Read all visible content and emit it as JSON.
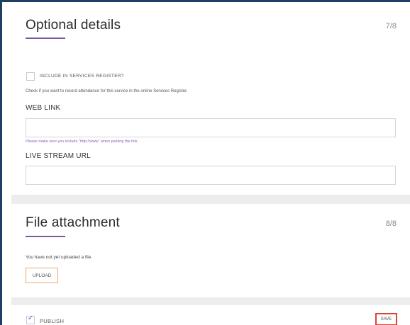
{
  "optional_details": {
    "title": "Optional details",
    "step": "7/8",
    "register_checkbox_label": "INCLUDE IN SERVICES REGISTER?",
    "register_checked": false,
    "register_help": "Check if you want to record attendance for this service in the online Services Register.",
    "web_link_label": "WEB LINK",
    "web_link_value": "",
    "web_link_hint": "Please make sure you include \"http://www\" when pasting the link.",
    "live_stream_label": "LIVE STREAM URL",
    "live_stream_value": ""
  },
  "file_attachment": {
    "title": "File attachment",
    "step": "8/8",
    "status_text": "You have not yet uploaded a file.",
    "upload_label": "UPLOAD"
  },
  "footer": {
    "publish_label": "PUBLISH",
    "publish_checked": true,
    "save_label": "SAVE"
  },
  "colors": {
    "frame_border": "#1c3f66",
    "accent_purple": "#7b55a6",
    "upload_border": "#f0a66a",
    "save_highlight": "#d9443a"
  }
}
